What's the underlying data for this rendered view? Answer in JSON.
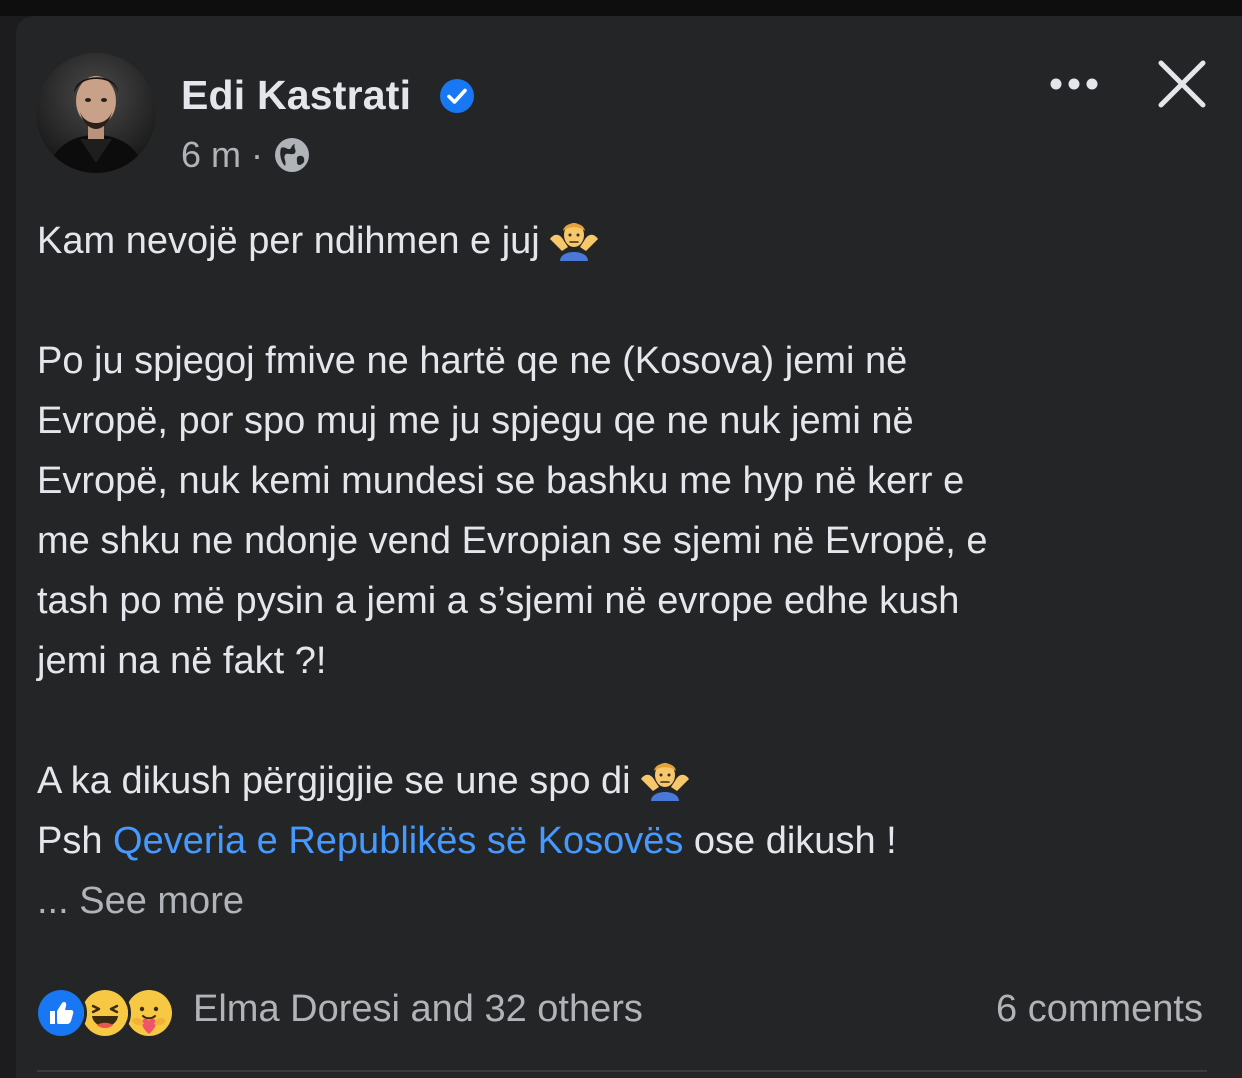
{
  "post": {
    "author": {
      "name": "Edi Kastrati",
      "verified": true
    },
    "meta": {
      "time": "6 m",
      "separator": "·",
      "audience_icon": "globe-icon"
    },
    "actions": {
      "more_icon": "more-options-icon",
      "close_icon": "close-icon"
    },
    "body": {
      "line1": "Kam nevojë per ndihmen e juj",
      "line1_emoji": "man-shrugging-emoji",
      "para2_lines": [
        "Po ju spjegoj fmive ne hartë qe ne (Kosova) jemi në",
        "Evropë, por spo muj me ju spjegu qe ne nuk jemi në",
        "Evropë, nuk kemi mundesi se bashku me hyp në kerr e",
        "me shku ne ndonje vend Evropian se sjemi në Evropë, e",
        "tash po më pysin a jemi a s’sjemi në evrope edhe kush",
        "jemi na në fakt ?!"
      ],
      "para3_line1": "A ka dikush përgjigjie se une spo di",
      "para3_line1_emoji": "man-shrugging-emoji",
      "para3_line2_prefix": "Psh",
      "para3_link": "Qeveria e Republikës së Kosovës",
      "para3_line2_suffix": "ose dikush !",
      "see_more": "... See more"
    },
    "footer": {
      "reactions": [
        "like-icon",
        "haha-icon",
        "care-icon"
      ],
      "reactors_text": "Elma Doresi and 32 others",
      "comments_text": "6 comments"
    }
  },
  "colors": {
    "background": "#242526",
    "text": "#e4e6eb",
    "secondary_text": "#b0b3b8",
    "link": "#4599ff",
    "verified_badge": "#1877f2"
  }
}
